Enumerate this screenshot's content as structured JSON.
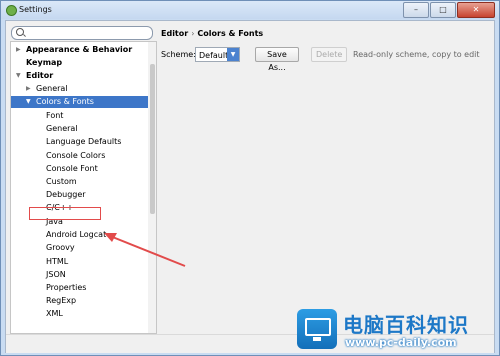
{
  "window": {
    "title": "Settings",
    "controls": [
      "–",
      "□",
      "✕"
    ]
  },
  "search": {
    "placeholder": ""
  },
  "tree": {
    "appearance": "Appearance & Behavior",
    "keymap": "Keymap",
    "editor": "Editor",
    "general": "General",
    "colors_fonts": "Colors & Fonts",
    "children": [
      "Font",
      "General",
      "Language Defaults",
      "Console Colors",
      "Console Font",
      "Custom",
      "Debugger",
      "C/C++",
      "Java",
      "Android Logcat",
      "Groovy",
      "HTML",
      "JSON",
      "Properties",
      "RegExp",
      "XML"
    ]
  },
  "breadcrumb": {
    "part1": "Editor",
    "separator": "›",
    "part2": "Colors & Fonts"
  },
  "scheme": {
    "label": "Scheme:",
    "value": "Default",
    "save_as": "Save As...",
    "delete": "Delete",
    "note": "Read-only scheme, copy to edit"
  },
  "watermark": {
    "title": "电脑百科知识",
    "url": "www.pc-daily.com"
  },
  "colors": {
    "selection": "#3d76c8",
    "annotation": "#e24b4b",
    "brand": "#1d78c7"
  }
}
